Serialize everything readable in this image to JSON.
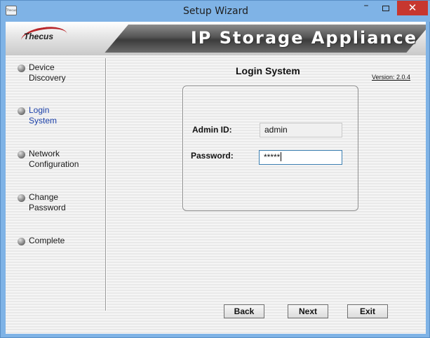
{
  "window": {
    "title": "Setup Wizard",
    "app_icon_text": "Thecus",
    "controls": {
      "minimize": "–",
      "close": "✕"
    }
  },
  "banner": {
    "logo": "Thecus",
    "product": "IP Storage Appliance"
  },
  "sidebar": {
    "steps": [
      {
        "label_line1": "Device",
        "label_line2": "Discovery",
        "active": false
      },
      {
        "label_line1": "Login",
        "label_line2": "System",
        "active": true
      },
      {
        "label_line1": "Network",
        "label_line2": "Configuration",
        "active": false
      },
      {
        "label_line1": "Change",
        "label_line2": "Password",
        "active": false
      },
      {
        "label_line1": "Complete",
        "label_line2": "",
        "active": false
      }
    ]
  },
  "main": {
    "title": "Login System",
    "version": "Version: 2.0.4",
    "form": {
      "admin_label": "Admin ID:",
      "admin_value": "admin",
      "password_label": "Password:",
      "password_value": "*****"
    }
  },
  "footer": {
    "back_label": "Back",
    "next_label": "Next",
    "exit_label": "Exit"
  },
  "colors": {
    "active_step": "#1a3fa8",
    "titlebar": "#7fb3e6",
    "close_button": "#c7372f",
    "focus_border": "#3c7fb1"
  }
}
